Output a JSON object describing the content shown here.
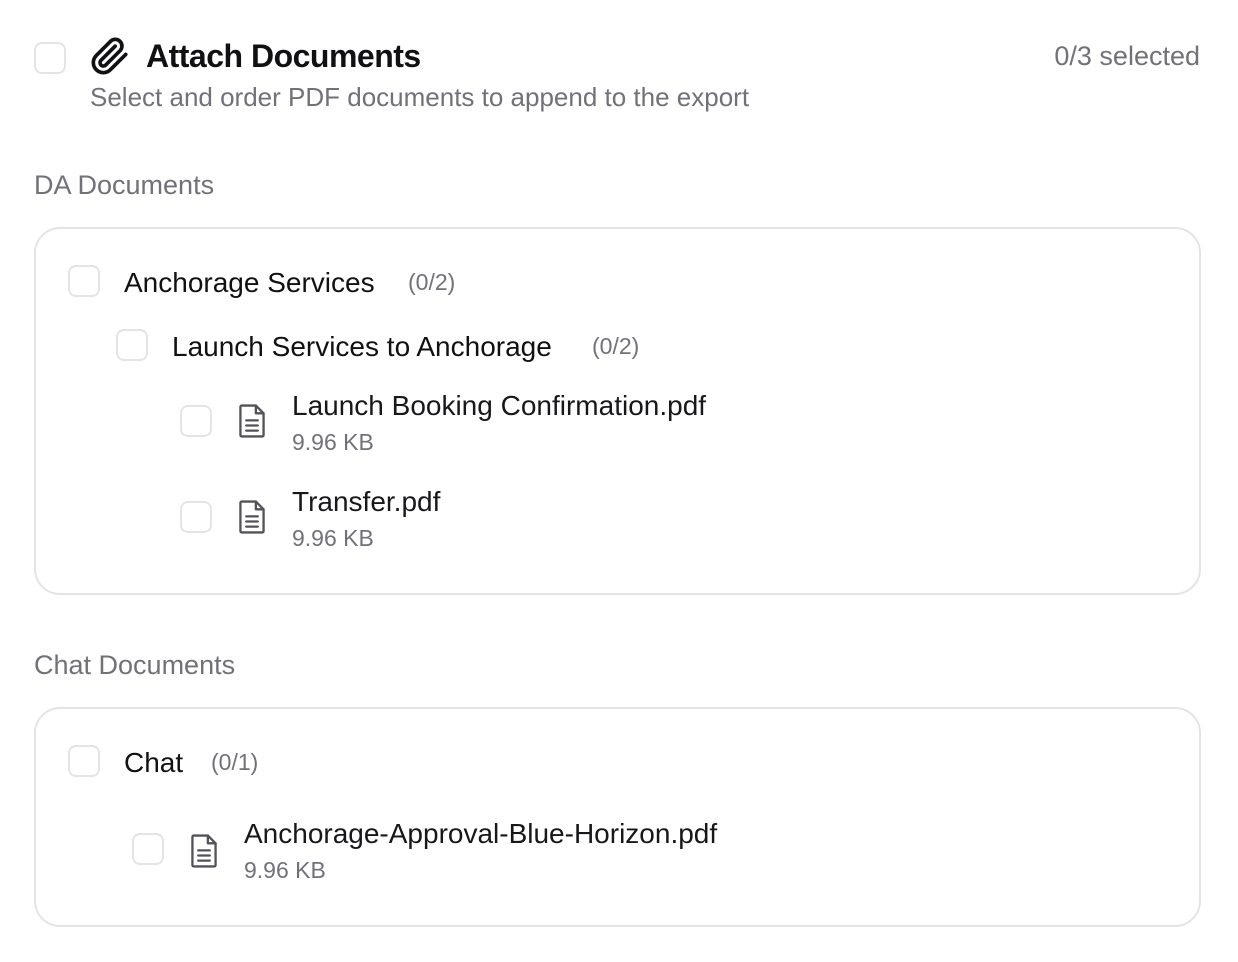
{
  "header": {
    "title": "Attach Documents",
    "subtitle": "Select and order PDF documents to append to the export",
    "selected_count": "0/3 selected",
    "icon": "paperclip-icon"
  },
  "sections": [
    {
      "label": "DA Documents",
      "groups": [
        {
          "label": "Anchorage Services",
          "count": "(0/2)",
          "subgroups": [
            {
              "label": "Launch Services to Anchorage",
              "count": "(0/2)",
              "files": [
                {
                  "name": "Launch Booking Confirmation.pdf",
                  "size": "9.96 KB",
                  "icon": "file-text-icon"
                },
                {
                  "name": "Transfer.pdf",
                  "size": "9.96 KB",
                  "icon": "file-text-icon"
                }
              ]
            }
          ]
        }
      ]
    },
    {
      "label": "Chat Documents",
      "groups": [
        {
          "label": "Chat",
          "count": "(0/1)",
          "files": [
            {
              "name": "Anchorage-Approval-Blue-Horizon.pdf",
              "size": "9.96 KB",
              "icon": "file-text-icon"
            }
          ]
        }
      ]
    }
  ],
  "colors": {
    "text_primary": "#111113",
    "text_muted": "#71717a",
    "border": "#e4e4e7",
    "background": "#ffffff"
  }
}
